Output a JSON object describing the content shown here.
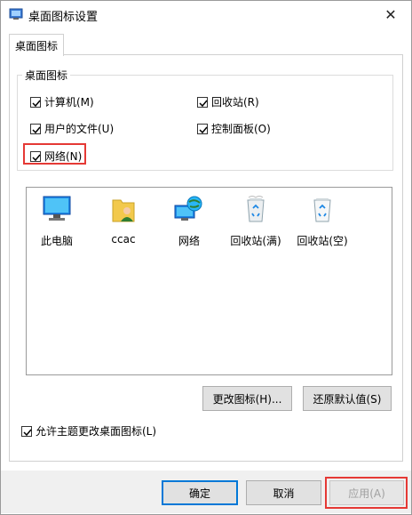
{
  "window": {
    "title": "桌面图标设置",
    "close_glyph": "✕"
  },
  "tab": {
    "label": "桌面图标"
  },
  "group": {
    "label": "桌面图标",
    "checkboxes": [
      {
        "label": "计算机(M)",
        "checked": true
      },
      {
        "label": "回收站(R)",
        "checked": true
      },
      {
        "label": "用户的文件(U)",
        "checked": true
      },
      {
        "label": "控制面板(O)",
        "checked": true
      },
      {
        "label": "网络(N)",
        "checked": true
      }
    ]
  },
  "icons": [
    {
      "label": "此电脑",
      "icon": "computer-icon"
    },
    {
      "label": "ccac",
      "icon": "user-folder-icon"
    },
    {
      "label": "网络",
      "icon": "network-icon"
    },
    {
      "label": "回收站(满)",
      "icon": "recycle-bin-full-icon"
    },
    {
      "label": "回收站(空)",
      "icon": "recycle-bin-empty-icon"
    }
  ],
  "actions": {
    "change_icon": "更改图标(H)...",
    "restore_default": "还原默认值(S)"
  },
  "theme_checkbox": {
    "label": "允许主题更改桌面图标(L)",
    "checked": true
  },
  "footer": {
    "ok": "确定",
    "cancel": "取消",
    "apply": "应用(A)"
  },
  "colors": {
    "highlight": "#e53935",
    "default_button_border": "#0078d7"
  }
}
